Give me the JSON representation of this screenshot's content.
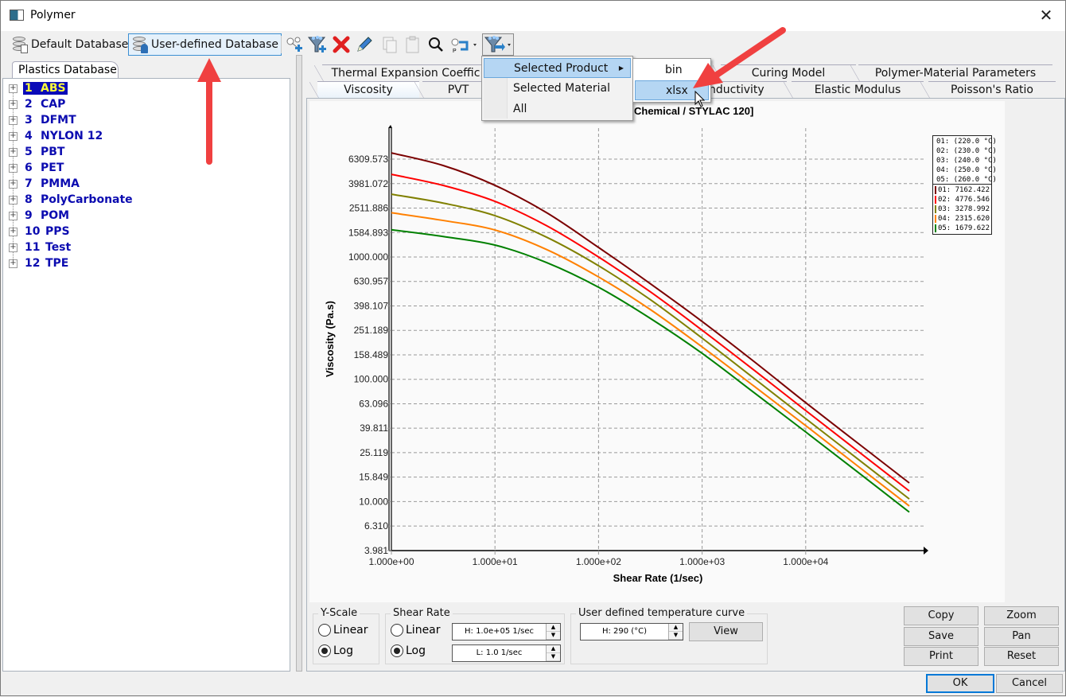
{
  "window": {
    "title": "Polymer",
    "close_icon": "close-icon"
  },
  "toolbar": {
    "default_db_label": "Default Database",
    "user_db_label": "User-defined Database",
    "icons": [
      "add-material-icon",
      "add-filter-icon",
      "delete-icon",
      "edit-pencil-icon",
      "copy-icon",
      "paste-icon",
      "search-icon",
      "properties-dropdown-icon",
      "export-filter-dropdown-icon"
    ]
  },
  "left_panel": {
    "tab_label": "Plastics Database",
    "items": [
      {
        "num": "1",
        "name": "ABS",
        "selected": true
      },
      {
        "num": "2",
        "name": "CAP"
      },
      {
        "num": "3",
        "name": "DFMT"
      },
      {
        "num": "4",
        "name": "NYLON 12"
      },
      {
        "num": "5",
        "name": "PBT"
      },
      {
        "num": "6",
        "name": "PET"
      },
      {
        "num": "7",
        "name": "PMMA"
      },
      {
        "num": "8",
        "name": "PolyCarbonate"
      },
      {
        "num": "9",
        "name": "POM"
      },
      {
        "num": "10",
        "name": "PPS"
      },
      {
        "num": "11",
        "name": "Test"
      },
      {
        "num": "12",
        "name": "TPE"
      }
    ]
  },
  "tabs": {
    "row1": [
      "Thermal Expansion Coeffic",
      "Curing Model",
      "Polymer-Material Parameters"
    ],
    "row2": [
      "Viscosity",
      "PVT",
      "nductivity",
      "Elastic Modulus",
      "Poisson's Ratio"
    ],
    "active": "Viscosity"
  },
  "export_menu": {
    "items": [
      "Selected Product",
      "Selected Material",
      "All"
    ],
    "highlighted": "Selected Product",
    "submenu": [
      "bin",
      "xlsx"
    ],
    "submenu_highlighted": "xlsx"
  },
  "chart_data": {
    "type": "line",
    "title": "Chemical / STYLAC 120]",
    "xlabel": "Shear Rate (1/sec)",
    "ylabel": "Viscosity (Pa.s)",
    "xscale": "log",
    "yscale": "log",
    "xlim": [
      1,
      100000
    ],
    "ylim": [
      3.981,
      10000
    ],
    "x_ticks": [
      "1.000e+00",
      "1.000e+01",
      "1.000e+02",
      "1.000e+03",
      "1.000e+04"
    ],
    "x_tick_values": [
      1,
      10,
      100,
      1000,
      10000
    ],
    "y_ticks": [
      "6309.573",
      "3981.072",
      "2511.886",
      "1584.893",
      "1000.000",
      "630.957",
      "398.107",
      "251.189",
      "158.489",
      "100.000",
      "63.096",
      "39.811",
      "25.119",
      "15.849",
      "10.000",
      "6.310",
      "3.981"
    ],
    "y_tick_values": [
      6309.573,
      3981.072,
      2511.886,
      1584.893,
      1000,
      630.957,
      398.107,
      251.189,
      158.489,
      100,
      63.096,
      39.811,
      25.119,
      15.849,
      10,
      6.31,
      3.981
    ],
    "grid": true,
    "legend_position": "top-right",
    "x": [
      1,
      3.16,
      10,
      31.6,
      100,
      316,
      1000,
      3162,
      10000,
      31623,
      100000
    ],
    "series": [
      {
        "name": "01: (220.0 °C)",
        "color": "#7b0000",
        "zero_shear": "01: 7162.422",
        "values": [
          7100,
          5600,
          3855,
          2300,
          1197,
          605,
          297,
          140,
          64.4,
          30.2,
          14.2
        ]
      },
      {
        "name": "02: (230.0 °C)",
        "color": "#ff0000",
        "zero_shear": "02: 4776.546",
        "values": [
          4740,
          3850,
          2850,
          1800,
          1000,
          520,
          252,
          119,
          55.5,
          26.0,
          12.2
        ]
      },
      {
        "name": "03: (240.0 °C)",
        "color": "#808000",
        "zero_shear": "03: 3278.992",
        "values": [
          3260,
          2760,
          2178,
          1450,
          848,
          448,
          217,
          102,
          47.7,
          22.4,
          10.5
        ]
      },
      {
        "name": "04: (250.0 °C)",
        "color": "#ff8000",
        "zero_shear": "04: 2315.620",
        "values": [
          2300,
          1990,
          1663,
          1150,
          687,
          372,
          184,
          88,
          41.8,
          19.6,
          9.2
        ]
      },
      {
        "name": "05: (260.0 °C)",
        "color": "#008000",
        "zero_shear": "05: 1679.622",
        "values": [
          1670,
          1470,
          1252,
          900,
          566,
          315,
          163,
          78,
          37.1,
          17.5,
          8.2
        ]
      }
    ]
  },
  "controls": {
    "yscale": {
      "label": "Y-Scale",
      "options": [
        "Linear",
        "Log"
      ],
      "selected": "Log"
    },
    "shear_rate": {
      "label": "Shear Rate",
      "options": [
        "Linear",
        "Log"
      ],
      "selected": "Log",
      "high": "H: 1.0e+05 1/sec",
      "low": "L: 1.0 1/sec"
    },
    "temp_curve": {
      "label": "User defined temperature curve",
      "value": "H: 290 (°C)",
      "view_label": "View"
    },
    "buttons": {
      "copy": "Copy",
      "zoom": "Zoom",
      "save": "Save",
      "pan": "Pan",
      "print": "Print",
      "reset": "Reset"
    }
  },
  "dialog": {
    "ok": "OK",
    "cancel": "Cancel"
  },
  "colors": {
    "accent": "#0078d7",
    "selection_bg": "#0a0ab8",
    "selection_fg": "#ffff3a",
    "tree_text": "#0c0cb0",
    "annotation_arrow": "#f04040"
  }
}
